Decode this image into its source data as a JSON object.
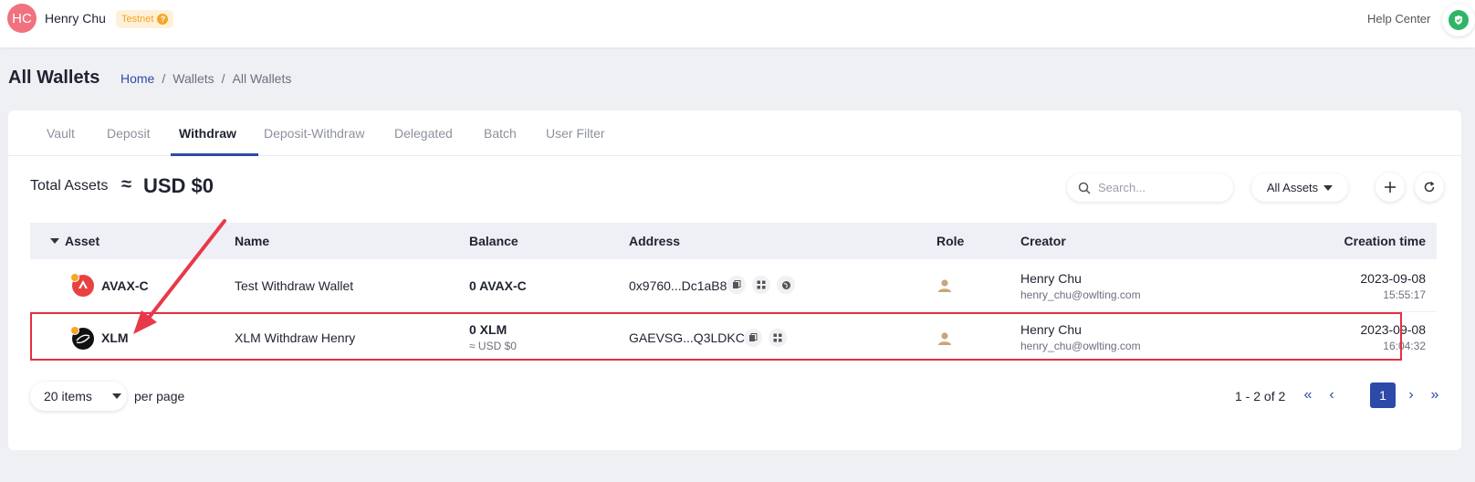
{
  "topbar": {
    "avatar_initials": "HC",
    "user_name": "Henry Chu",
    "network_badge": "Testnet",
    "help_center": "Help Center"
  },
  "page": {
    "title": "All Wallets",
    "breadcrumb": [
      "Home",
      "Wallets",
      "All Wallets"
    ]
  },
  "tabs": [
    "Vault",
    "Deposit",
    "Withdraw",
    "Deposit-Withdraw",
    "Delegated",
    "Batch",
    "User Filter"
  ],
  "active_tab": "Withdraw",
  "summary": {
    "label": "Total Assets",
    "approx": "≈",
    "value": "USD $0"
  },
  "toolbar": {
    "search_placeholder": "Search...",
    "assets_filter": "All Assets"
  },
  "table": {
    "headers": [
      "Asset",
      "Name",
      "Balance",
      "Address",
      "Role",
      "Creator",
      "Creation time"
    ],
    "rows": [
      {
        "asset": "AVAX-C",
        "name": "Test Withdraw Wallet",
        "balance": "0 AVAX-C",
        "balance_usd": "",
        "address": "0x9760...Dc1aB8",
        "creator_name": "Henry Chu",
        "creator_email": "henry_chu@owlting.com",
        "date": "2023-09-08",
        "time": "15:55:17"
      },
      {
        "asset": "XLM",
        "name": "XLM Withdraw Henry",
        "balance": "0 XLM",
        "balance_usd": "≈ USD $0",
        "address": "GAEVSG...Q3LDKC",
        "creator_name": "Henry Chu",
        "creator_email": "henry_chu@owlting.com",
        "date": "2023-09-08",
        "time": "16:04:32"
      }
    ]
  },
  "pagination": {
    "per_page_value": "20 items",
    "per_page_label": "per page",
    "range": "1 - 2 of 2",
    "current_page": "1"
  },
  "colors": {
    "accent": "#2d4aa8",
    "highlight": "#e33042",
    "avatar": "#f0727e",
    "badge_text": "#f5a623"
  }
}
